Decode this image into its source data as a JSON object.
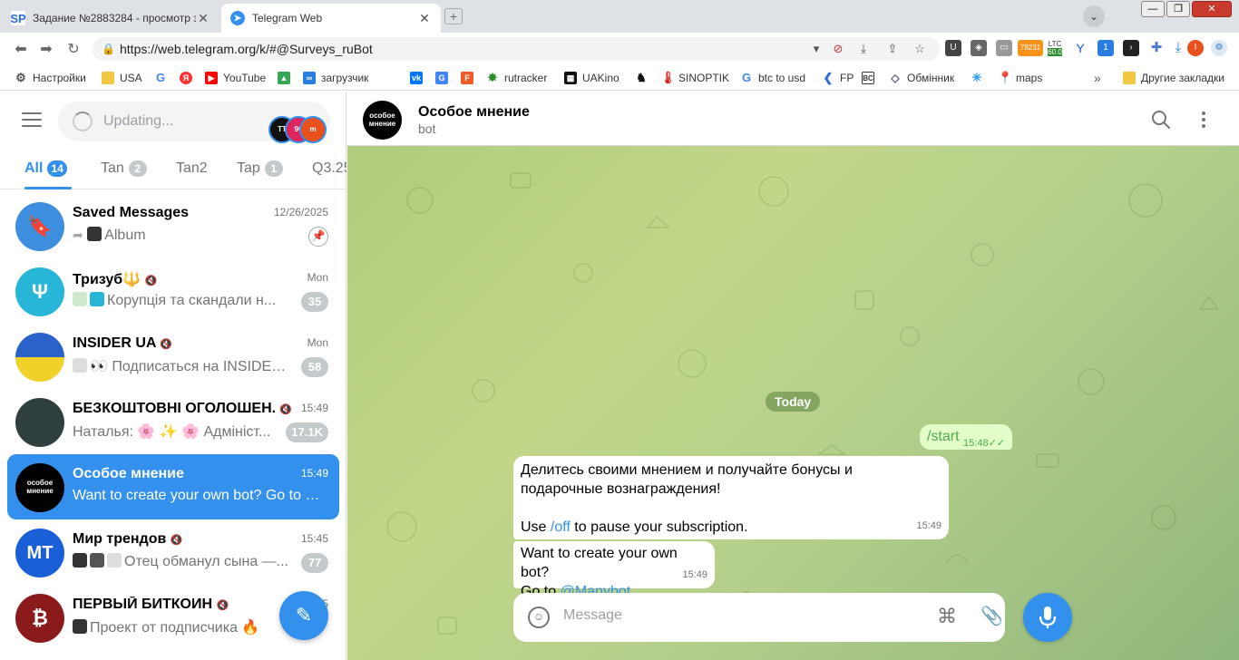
{
  "browser": {
    "tabs": [
      {
        "title": "Задание №2883284 - просмотр з",
        "favicon": "SP",
        "active": false
      },
      {
        "title": "Telegram Web",
        "favicon": "telegram-icon",
        "active": true
      }
    ],
    "url": "https://web.telegram.org/k/#@Surveys_ruBot",
    "extensions": {
      "badge_count": "78231",
      "ltc_label": "LTC",
      "ltc_value": "60.0",
      "badge_one": "1",
      "profile_letter": "I"
    },
    "bookmarks": [
      {
        "label": "Настройки",
        "icon": "gear-icon"
      },
      {
        "label": "USA",
        "icon": "folder-icon"
      },
      {
        "label": "",
        "icon": "google-icon"
      },
      {
        "label": "",
        "icon": "yandex-icon"
      },
      {
        "label": "YouTube",
        "icon": "youtube-icon"
      },
      {
        "label": "",
        "icon": "drive-icon"
      },
      {
        "label": "загрузчик",
        "icon": "infinity-icon"
      },
      {
        "label": "",
        "icon": "vk-icon"
      },
      {
        "label": "",
        "icon": "translate-icon"
      },
      {
        "label": "",
        "icon": "f-icon"
      },
      {
        "label": "rutracker",
        "icon": "rutracker-icon"
      },
      {
        "label": "UAKino",
        "icon": "uakino-icon"
      },
      {
        "label": "",
        "icon": "chess-icon"
      },
      {
        "label": "SINOPTIK",
        "icon": "thermometer-icon"
      },
      {
        "label": "btc to usd",
        "icon": "google-icon"
      },
      {
        "label": "FP",
        "icon": "fp-icon"
      },
      {
        "label": "",
        "icon": "bc-icon"
      },
      {
        "label": "Обмінник",
        "icon": "exchange-icon"
      },
      {
        "label": "",
        "icon": "star-icon"
      },
      {
        "label": "maps",
        "icon": "maps-icon"
      }
    ],
    "bookmarks_more": "»",
    "other_bookmarks": "Другие закладки"
  },
  "sidebar": {
    "search_placeholder": "Updating...",
    "folders": [
      {
        "label": "All",
        "count": "14",
        "active": true
      },
      {
        "label": "Tan",
        "count": "2",
        "active": false
      },
      {
        "label": "Tan2",
        "count": "",
        "active": false
      },
      {
        "label": "Tap",
        "count": "1",
        "active": false
      },
      {
        "label": "Q3.25",
        "count": "",
        "active": false
      }
    ],
    "chats": [
      {
        "name": "Saved Messages",
        "time": "12/26/2025",
        "preview": "Album",
        "badge": "",
        "pinned": true,
        "muted": false,
        "avatar_color": "#3d8ede",
        "active": false
      },
      {
        "name": "Тризуб🔱",
        "time": "Mon",
        "preview": "Корупція та скандали н...",
        "badge": "35",
        "pinned": false,
        "muted": true,
        "avatar_color": "#27b5d8",
        "active": false
      },
      {
        "name": "INSIDER UA",
        "time": "Mon",
        "preview": "👀 Подписаться на INSIDER...",
        "badge": "58",
        "pinned": false,
        "muted": true,
        "avatar_color": "#1d57b8",
        "active": false
      },
      {
        "name": "БЕЗКОШТОВНІ ОГОЛОШЕН...",
        "time": "15:49",
        "preview": "Наталья: 🌸 ✨ 🌸 Адмініст...",
        "badge": "17.1K",
        "pinned": false,
        "muted": true,
        "avatar_color": "#2f3f3f",
        "active": false
      },
      {
        "name": "Особое мнение",
        "time": "15:49",
        "preview": "Want to create your own bot? Go to @...",
        "badge": "",
        "pinned": false,
        "muted": false,
        "avatar_color": "#000000",
        "active": true
      },
      {
        "name": "Мир трендов",
        "time": "15:45",
        "preview": "Отец обманул сына —...",
        "badge": "77",
        "pinned": false,
        "muted": true,
        "avatar_color": "#1a5fd8",
        "active": false
      },
      {
        "name": "ПЕРВЫЙ БИТКОИН",
        "time": "15",
        "preview": "Проект от подписчика 🔥",
        "badge": "",
        "pinned": false,
        "muted": true,
        "avatar_color": "#8b1a1a",
        "active": false
      }
    ]
  },
  "chat": {
    "name": "Особое мнение",
    "status": "bot",
    "avatar_text": "особое мнение",
    "date_label": "Today",
    "messages": [
      {
        "dir": "out",
        "text": "/start",
        "time": "15:48"
      },
      {
        "dir": "in",
        "line1": "Делитесь своими мнением и получайте бонусы и",
        "line2": "подарочные вознаграждения!",
        "line3a": "Use ",
        "link": "/off",
        "line3b": " to pause your subscription.",
        "time": "15:49"
      },
      {
        "dir": "in",
        "line1": "Want to create your own bot?",
        "line2a": "Go to ",
        "link": "@Manybot",
        "time": "15:49"
      }
    ],
    "composer_placeholder": "Message"
  },
  "colors": {
    "accent": "#3390ec",
    "outgoing_bubble": "#e2fdc8",
    "chat_bg": "#b4cf8a"
  }
}
